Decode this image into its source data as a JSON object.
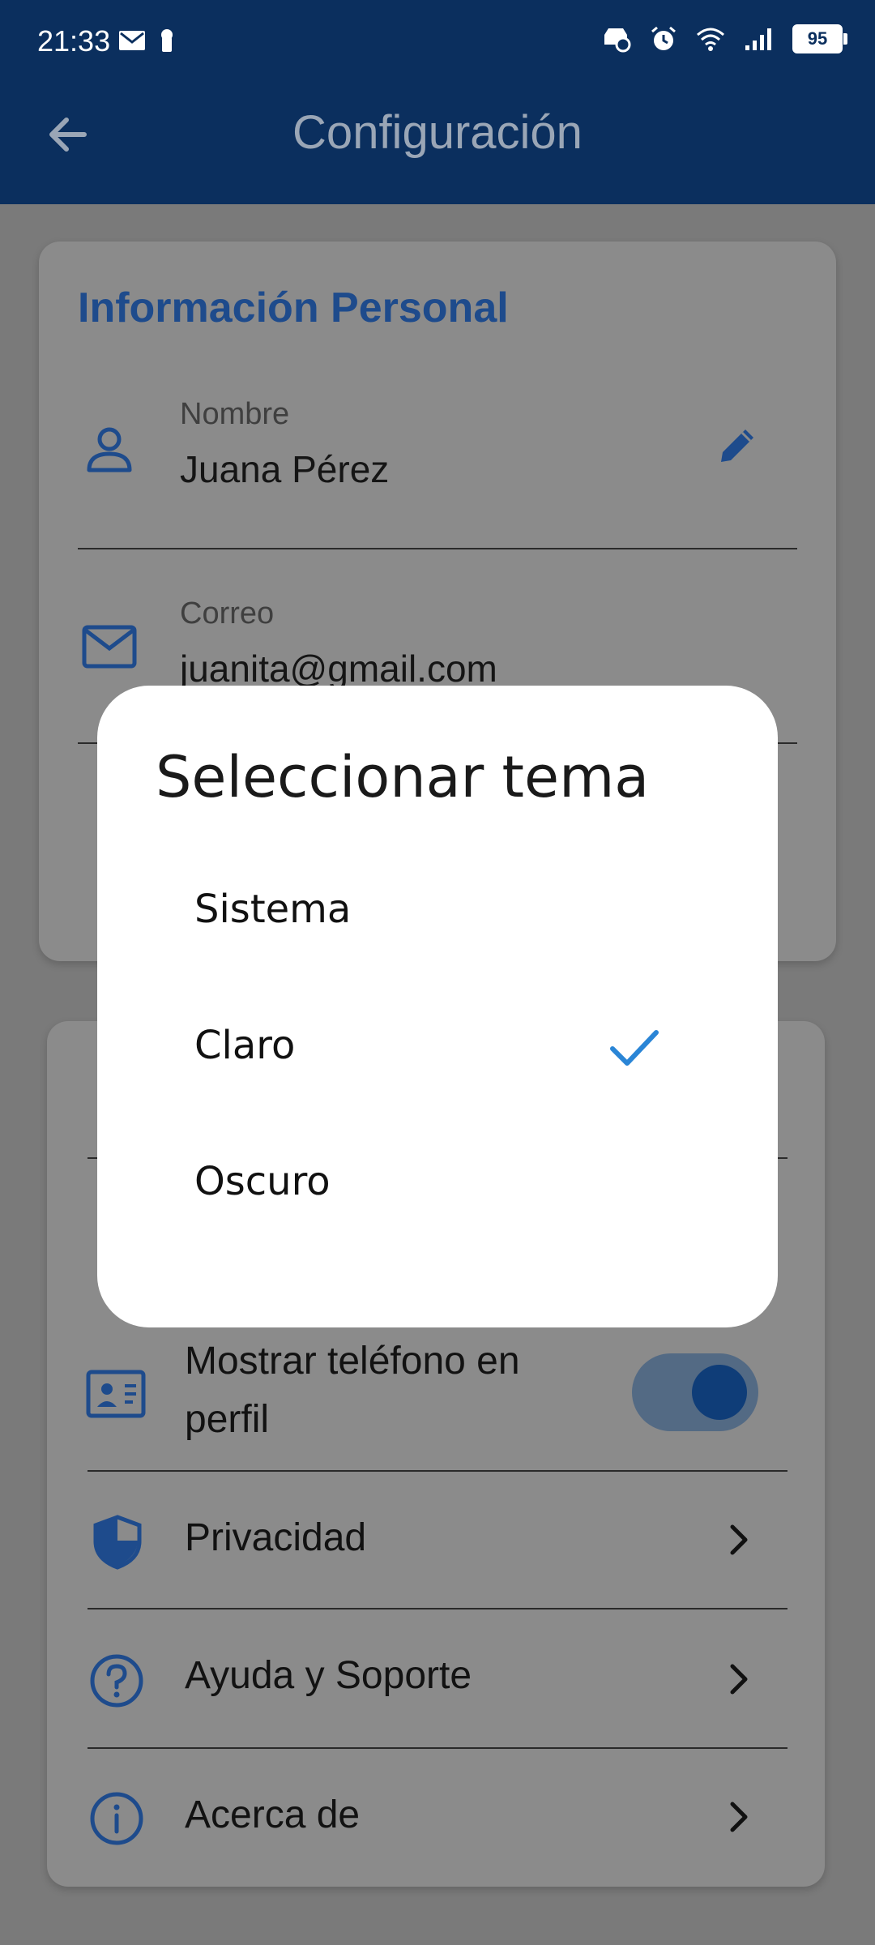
{
  "status": {
    "time": "21:33",
    "battery": "95",
    "icons": [
      "mail-icon",
      "keyhole-icon",
      "car-mode-icon",
      "alarm-icon",
      "wifi-icon",
      "signal-icon",
      "battery-icon"
    ]
  },
  "appbar": {
    "title": "Configuración",
    "back_icon": "arrow-left-icon"
  },
  "personal": {
    "section_title": "Información Personal",
    "name": {
      "label": "Nombre",
      "value": "Juana Pérez",
      "icon": "person-icon",
      "action_icon": "pencil-icon"
    },
    "email": {
      "label": "Correo",
      "value": "juanita@gmail.com",
      "icon": "mail-icon"
    }
  },
  "settings": {
    "items": [
      {
        "label": "Mostrar teléfono en perfil",
        "icon": "contact-card-icon",
        "toggle_on": true
      },
      {
        "label": "Privacidad",
        "icon": "shield-icon"
      },
      {
        "label": "Ayuda y Soporte",
        "icon": "help-circle-icon"
      },
      {
        "label": "Acerca de",
        "icon": "info-icon"
      }
    ]
  },
  "dialog": {
    "title": "Seleccionar tema",
    "options": [
      {
        "label": "Sistema",
        "selected": false
      },
      {
        "label": "Claro",
        "selected": true
      },
      {
        "label": "Oscuro",
        "selected": false
      }
    ]
  },
  "colors": {
    "appbar": "#0b2f5e",
    "accent": "#1e4b8c",
    "check": "#2a85d6",
    "dialog_bg": "#ffffff"
  }
}
